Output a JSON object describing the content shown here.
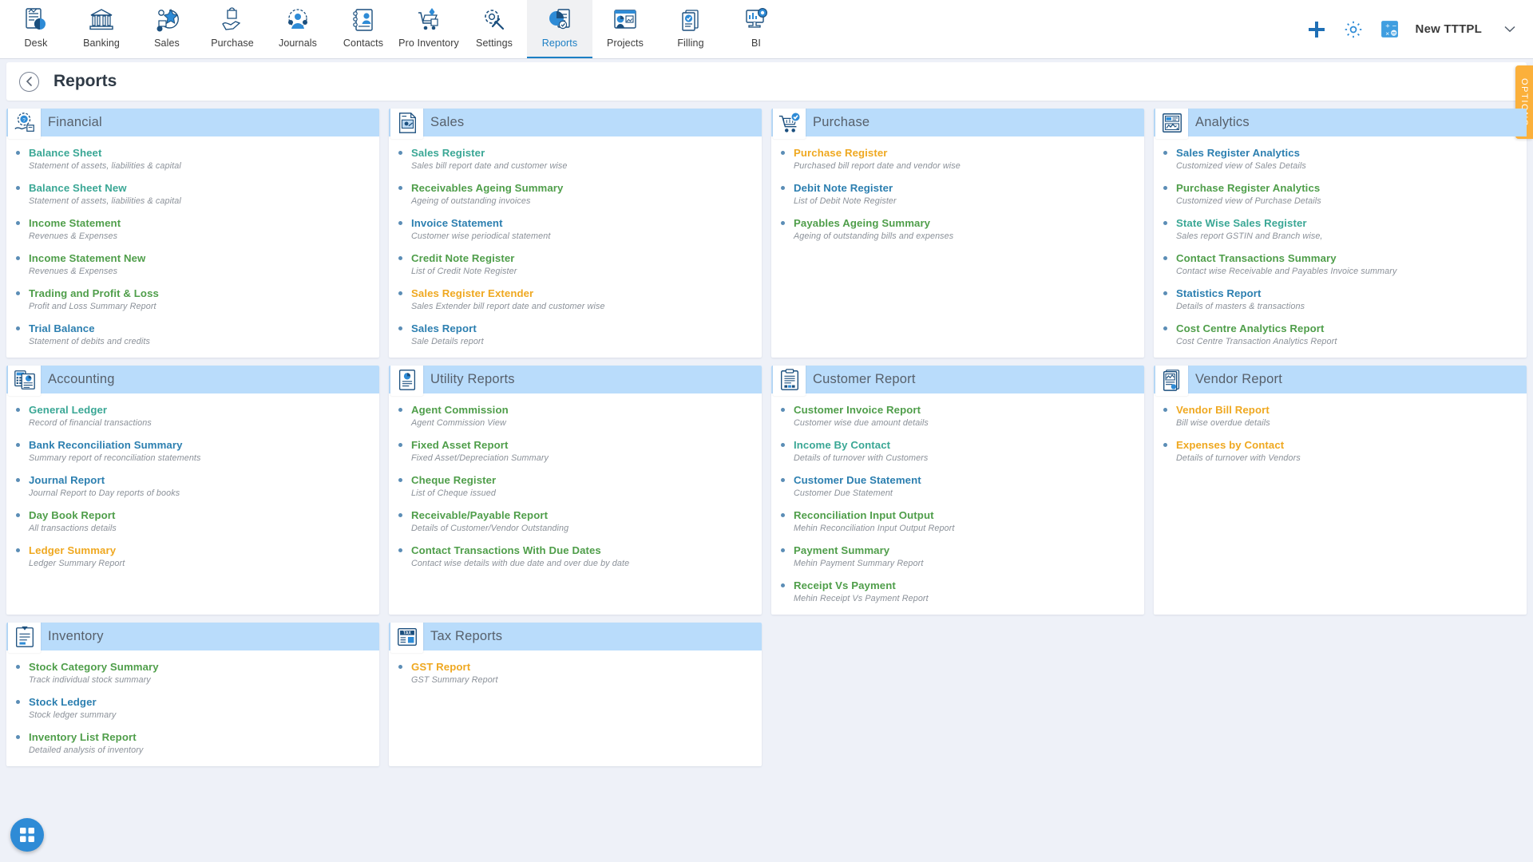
{
  "nav": {
    "items": [
      {
        "label": "Desk",
        "icon": "desk-icon"
      },
      {
        "label": "Banking",
        "icon": "bank-icon"
      },
      {
        "label": "Sales",
        "icon": "sales-icon"
      },
      {
        "label": "Purchase",
        "icon": "purchase-icon"
      },
      {
        "label": "Journals",
        "icon": "journals-icon"
      },
      {
        "label": "Contacts",
        "icon": "contacts-icon"
      },
      {
        "label": "Pro Inventory",
        "icon": "inventory-icon"
      },
      {
        "label": "Settings",
        "icon": "settings-icon"
      },
      {
        "label": "Reports",
        "icon": "reports-icon"
      },
      {
        "label": "Projects",
        "icon": "projects-icon"
      },
      {
        "label": "Filling",
        "icon": "filling-icon"
      },
      {
        "label": "BI",
        "icon": "bi-icon"
      }
    ],
    "active": "Reports",
    "actions": {
      "add": "add-icon",
      "settings": "gear-icon",
      "calculator": "calculator-icon"
    },
    "company": "New TTTPL",
    "company_caret": "chevron-down-icon"
  },
  "header": {
    "title": "Reports",
    "back": "back-arrow-icon"
  },
  "options_tab": {
    "label": "OPTIONS",
    "color": "#fbb03b"
  },
  "fab": {
    "icon": "grid-apps-icon",
    "color": "#2e8bd6"
  },
  "colors": {
    "teal": "#3aa795",
    "green": "#4f9e4a",
    "blue": "#2c7fb0",
    "amber": "#efa820",
    "card_header": "#b9dcfb",
    "page_bg": "#eef1f8"
  },
  "cards": [
    {
      "title": "Financial",
      "icon": "financial-icon",
      "items": [
        {
          "label": "Balance Sheet",
          "desc": "Statement of assets, liabilities & capital",
          "color": "teal"
        },
        {
          "label": "Balance Sheet New",
          "desc": "Statement of assets, liabilities & capital",
          "color": "teal"
        },
        {
          "label": "Income Statement",
          "desc": "Revenues & Expenses",
          "color": "green"
        },
        {
          "label": "Income Statement New",
          "desc": "Revenues & Expenses",
          "color": "green"
        },
        {
          "label": "Trading and Profit & Loss",
          "desc": "Profit and Loss Summary Report",
          "color": "green"
        },
        {
          "label": "Trial Balance",
          "desc": "Statement of debits and credits",
          "color": "blue"
        }
      ]
    },
    {
      "title": "Sales",
      "icon": "sales-report-icon",
      "items": [
        {
          "label": "Sales Register",
          "desc": "Sales bill report date and customer wise",
          "color": "teal"
        },
        {
          "label": "Receivables Ageing Summary",
          "desc": "Ageing of outstanding invoices",
          "color": "green"
        },
        {
          "label": "Invoice Statement",
          "desc": "Customer wise periodical statement",
          "color": "blue"
        },
        {
          "label": "Credit Note Register",
          "desc": "List of Credit Note Register",
          "color": "green"
        },
        {
          "label": "Sales Register Extender",
          "desc": "Sales Extender bill report date and customer wise",
          "color": "amber"
        },
        {
          "label": "Sales Report",
          "desc": "Sale Details report",
          "color": "blue"
        }
      ]
    },
    {
      "title": "Purchase",
      "icon": "purchase-cart-icon",
      "items": [
        {
          "label": "Purchase Register",
          "desc": "Purchased bill report date and vendor wise",
          "color": "amber"
        },
        {
          "label": "Debit Note Register",
          "desc": "List of Debit Note Register",
          "color": "blue"
        },
        {
          "label": "Payables Ageing Summary",
          "desc": "Ageing of outstanding bills and expenses",
          "color": "green"
        }
      ]
    },
    {
      "title": "Analytics",
      "icon": "analytics-icon",
      "items": [
        {
          "label": "Sales Register Analytics",
          "desc": "Customized view of Sales Details",
          "color": "blue"
        },
        {
          "label": "Purchase Register Analytics",
          "desc": "Customized view of Purchase Details",
          "color": "green"
        },
        {
          "label": "State Wise Sales Register",
          "desc": "Sales report GSTIN and Branch wise,",
          "color": "teal"
        },
        {
          "label": "Contact Transactions Summary",
          "desc": "Contact wise Receivable and Payables Invoice summary",
          "color": "green"
        },
        {
          "label": "Statistics Report",
          "desc": "Details of masters & transactions",
          "color": "blue"
        },
        {
          "label": "Cost Centre Analytics Report",
          "desc": "Cost Centre Transaction Analytics Report",
          "color": "green"
        }
      ]
    },
    {
      "title": "Accounting",
      "icon": "accounting-icon",
      "items": [
        {
          "label": "General Ledger",
          "desc": "Record of financial transactions",
          "color": "teal"
        },
        {
          "label": "Bank Reconciliation Summary",
          "desc": "Summary report of reconciliation statements",
          "color": "blue"
        },
        {
          "label": "Journal Report",
          "desc": "Journal Report to Day reports of books",
          "color": "blue"
        },
        {
          "label": "Day Book Report",
          "desc": "All transactions details",
          "color": "green"
        },
        {
          "label": "Ledger Summary",
          "desc": "Ledger Summary Report",
          "color": "amber"
        }
      ]
    },
    {
      "title": "Utility Reports",
      "icon": "utility-icon",
      "items": [
        {
          "label": "Agent Commission",
          "desc": "Agent Commission View",
          "color": "green"
        },
        {
          "label": "Fixed Asset Report",
          "desc": "Fixed Asset/Depreciation Summary",
          "color": "green"
        },
        {
          "label": "Cheque Register",
          "desc": "List of Cheque issued",
          "color": "green"
        },
        {
          "label": "Receivable/Payable Report",
          "desc": "Details of Customer/Vendor Outstanding",
          "color": "green"
        },
        {
          "label": "Contact Transactions With Due Dates",
          "desc": "Contact wise details with due date and over due by date",
          "color": "green"
        }
      ]
    },
    {
      "title": "Customer Report",
      "icon": "customer-report-icon",
      "items": [
        {
          "label": "Customer Invoice Report",
          "desc": "Customer wise due amount details",
          "color": "green"
        },
        {
          "label": "Income By Contact",
          "desc": "Details of turnover with Customers",
          "color": "teal"
        },
        {
          "label": "Customer Due Statement",
          "desc": "Customer Due Statement",
          "color": "blue"
        },
        {
          "label": "Reconciliation Input Output",
          "desc": "Mehin Reconciliation Input Output Report",
          "color": "green"
        },
        {
          "label": "Payment Summary",
          "desc": "Mehin Payment Summary Report",
          "color": "green"
        },
        {
          "label": "Receipt Vs Payment",
          "desc": "Mehin Receipt Vs Payment Report",
          "color": "green"
        }
      ]
    },
    {
      "title": "Vendor Report",
      "icon": "vendor-report-icon",
      "items": [
        {
          "label": "Vendor Bill Report",
          "desc": "Bill wise overdue details",
          "color": "amber"
        },
        {
          "label": "Expenses by Contact",
          "desc": "Details of turnover with Vendors",
          "color": "amber"
        }
      ]
    },
    {
      "title": "Inventory",
      "icon": "inventory-report-icon",
      "items": [
        {
          "label": "Stock Category Summary",
          "desc": "Track individual stock summary",
          "color": "green"
        },
        {
          "label": "Stock Ledger",
          "desc": "Stock ledger summary",
          "color": "blue"
        },
        {
          "label": "Inventory List Report",
          "desc": "Detailed analysis of inventory",
          "color": "green"
        }
      ]
    },
    {
      "title": "Tax Reports",
      "icon": "tax-icon",
      "items": [
        {
          "label": "GST Report",
          "desc": "GST Summary Report",
          "color": "amber"
        }
      ]
    }
  ]
}
